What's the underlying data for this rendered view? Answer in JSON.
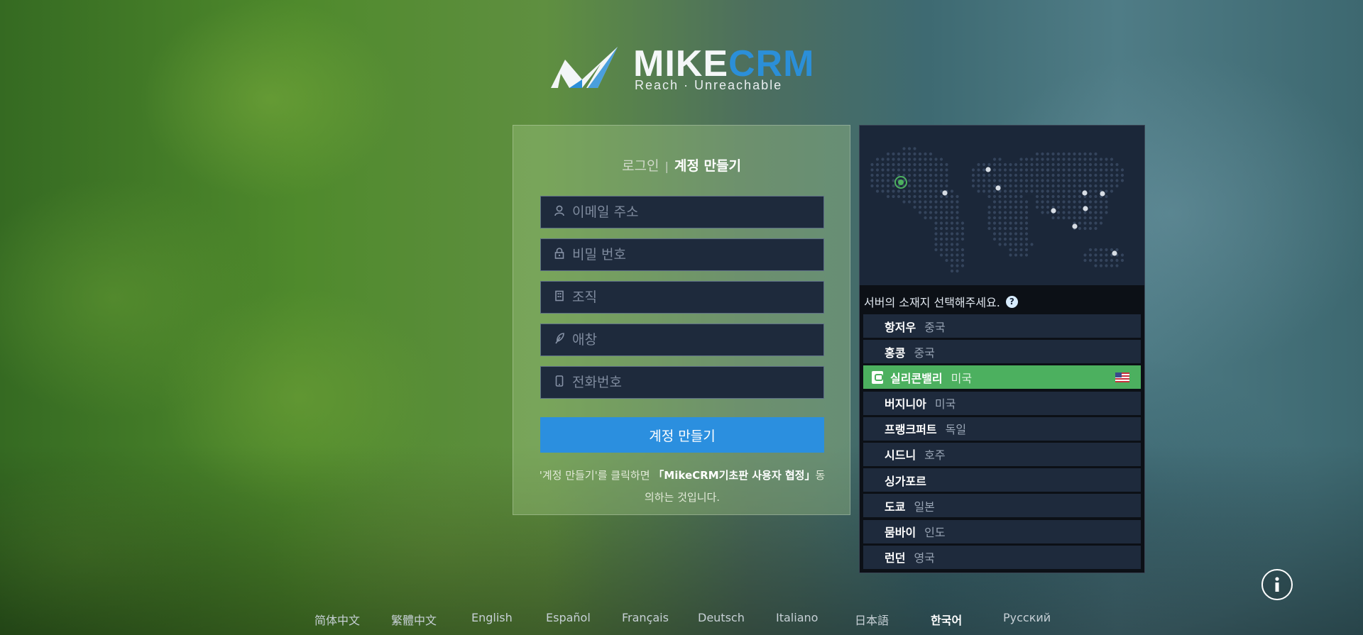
{
  "brand": {
    "name_part1": "MIKE",
    "name_part2": "CRM",
    "tagline": "Reach · Unreachable"
  },
  "auth_tabs": {
    "login": "로그인",
    "separator": "|",
    "register": "계정 만들기",
    "active": "register"
  },
  "form": {
    "fields": [
      {
        "name": "email",
        "icon": "user-icon",
        "placeholder": "이메일 주소",
        "value": ""
      },
      {
        "name": "password",
        "icon": "lock-icon",
        "placeholder": "비밀 번호",
        "value": ""
      },
      {
        "name": "organization",
        "icon": "building-icon",
        "placeholder": "조직",
        "value": ""
      },
      {
        "name": "nickname",
        "icon": "feather-icon",
        "placeholder": "애창",
        "value": ""
      },
      {
        "name": "phone",
        "icon": "phone-icon",
        "placeholder": "전화번호",
        "value": ""
      }
    ],
    "submit_label": "계정 만들기",
    "terms_prefix": "'계정 만들기'를 클릭하면",
    "terms_link": "「MikeCRM기초판 사용자 협정」",
    "terms_suffix": "동의하는 것입니다."
  },
  "server": {
    "header": "서버의 소재지 선택해주세요.",
    "help": "?",
    "items": [
      {
        "city": "항저우",
        "country": "중국"
      },
      {
        "city": "홍콩",
        "country": "중국"
      },
      {
        "city": "실리콘밸리",
        "country": "미국",
        "selected": true,
        "flag": "us-flag-icon"
      },
      {
        "city": "버지니아",
        "country": "미국"
      },
      {
        "city": "프랭크퍼트",
        "country": "독일"
      },
      {
        "city": "시드니",
        "country": "호주"
      },
      {
        "city": "싱가포르",
        "country": ""
      },
      {
        "city": "도쿄",
        "country": "일본"
      },
      {
        "city": "뭄바이",
        "country": "인도"
      },
      {
        "city": "런던",
        "country": "영국"
      }
    ]
  },
  "languages": [
    "简体中文",
    "繁體中文",
    "English",
    "Español",
    "Français",
    "Deutsch",
    "Italiano",
    "日本語",
    "한국어",
    "Русский"
  ],
  "active_language": "한국어",
  "colors": {
    "accent_blue": "#2b8fdf",
    "selected_green": "#4cb05f",
    "field_bg": "#1e2a3c",
    "panel_bg": "#0c1016"
  }
}
